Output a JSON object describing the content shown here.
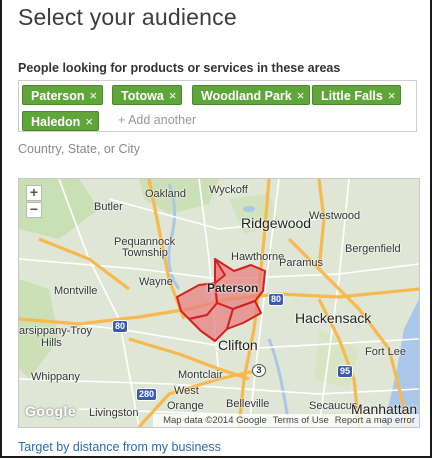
{
  "title": "Select your audience",
  "areas_label": "People looking for products or services in these areas",
  "tags": [
    {
      "label": "Paterson",
      "remove": "×"
    },
    {
      "label": "Totowa",
      "remove": "×"
    },
    {
      "label": "Woodland Park",
      "remove": "×"
    },
    {
      "label": "Little Falls",
      "remove": "×"
    },
    {
      "label": "Haledon",
      "remove": "×"
    }
  ],
  "add_placeholder": "+ Add another",
  "hint": "Country, State, or City",
  "map": {
    "zoom_in": "+",
    "zoom_out": "−",
    "places": {
      "oakland": "Oakland",
      "wyckoff": "Wyckoff",
      "butler": "Butler",
      "ridgewood": "Ridgewood",
      "westwood": "Westwood",
      "pequannock": "Pequannock",
      "township": "Township",
      "hawthorne": "Hawthorne",
      "paramus": "Paramus",
      "bergenfield": "Bergenfield",
      "montville": "Montville",
      "wayne": "Wayne",
      "paterson": "Paterson",
      "hackensack": "Hackensack",
      "parsippany": "arsippany-Troy",
      "hills": "Hills",
      "clifton": "Clifton",
      "fort_lee": "Fort Lee",
      "whippany": "Whippany",
      "montclair": "Montclair",
      "west": "West",
      "orange": "Orange",
      "belleville": "Belleville",
      "livingston": "Livingston",
      "secaucus": "Secaucus",
      "manhattan": "Manhattan"
    },
    "shields": {
      "i80a": "80",
      "i80b": "80",
      "r3": "3",
      "i95": "95",
      "i280": "280"
    },
    "logo": "Google",
    "attribution": {
      "data": "Map data ©2014 Google",
      "terms": "Terms of Use",
      "report": "Report a map error"
    },
    "colors": {
      "land": "#dfe6d5",
      "road_major": "#f6b94e",
      "road_minor": "#ffffff",
      "water": "#a9c7e8",
      "park": "#c7deb0",
      "selection_fill": "#e88080",
      "selection_stroke": "#d62020"
    }
  },
  "target_link": "Target by distance from my business"
}
